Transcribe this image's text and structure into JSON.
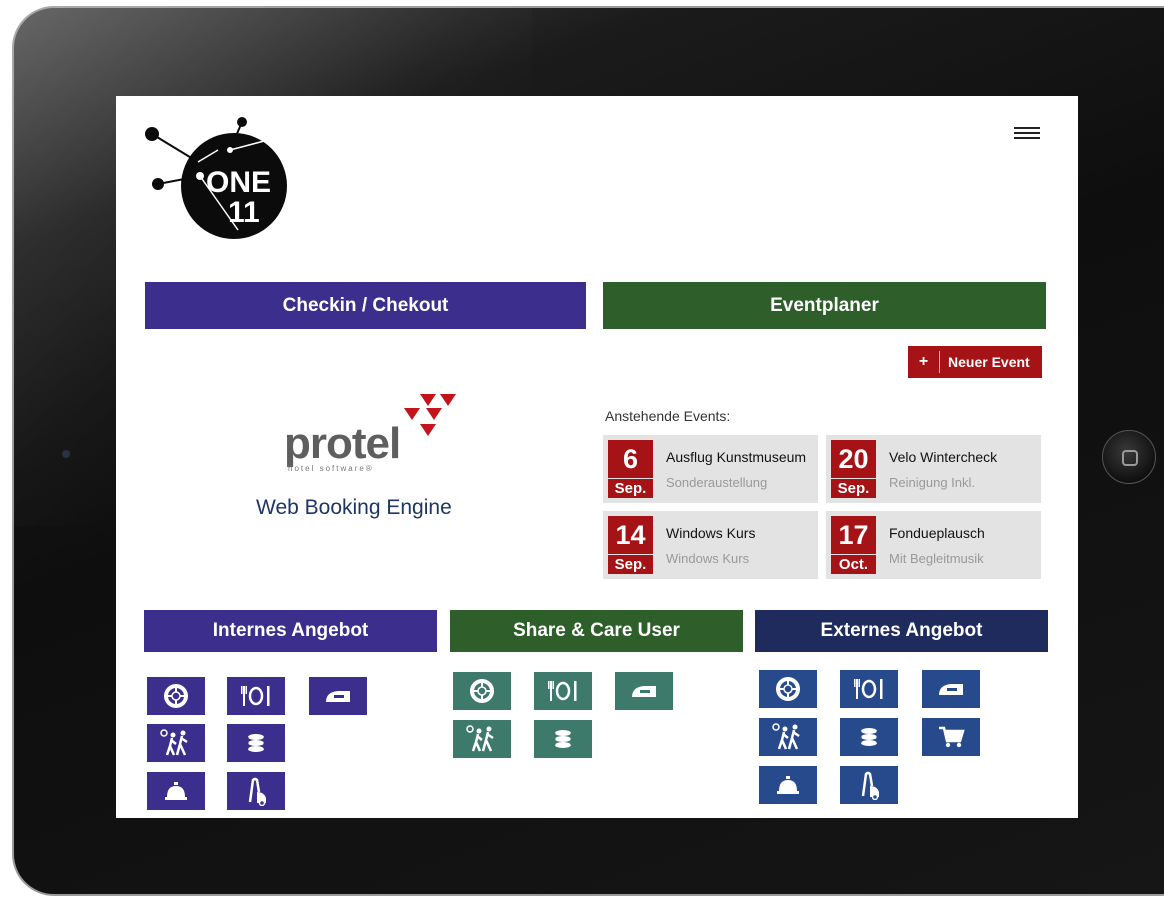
{
  "logo": {
    "line1": "ONE",
    "line2": "11"
  },
  "checkin": {
    "label": "Checkin / Chekout"
  },
  "protel": {
    "brand": "protel",
    "tagline": "hotel software®",
    "engine": "Web Booking Engine"
  },
  "eventplaner": {
    "label": "Eventplaner",
    "new_button_plus": "+",
    "new_button_label": "Neuer Event",
    "upcoming_label": "Anstehende Events:",
    "events": [
      {
        "day": "6",
        "month": "Sep.",
        "title": "Ausflug Kunstmuseum",
        "subtitle": "Sonderaustellung"
      },
      {
        "day": "20",
        "month": "Sep.",
        "title": "Velo Wintercheck",
        "subtitle": "Reinigung Inkl."
      },
      {
        "day": "14",
        "month": "Sep.",
        "title": "Windows Kurs",
        "subtitle": "Windows Kurs"
      },
      {
        "day": "17",
        "month": "Oct.",
        "title": "Fondueplausch",
        "subtitle": "Mit Begleitmusik"
      }
    ]
  },
  "sections": {
    "intern": {
      "label": "Internes Angebot",
      "color": "#3b2e8c"
    },
    "share": {
      "label": "Share & Care User",
      "color": "#3e7a6c"
    },
    "extern": {
      "label": "Externes Angebot",
      "color": "#264a8c"
    }
  },
  "colors": {
    "red": "#a51316",
    "purple": "#3b2e8c",
    "green": "#2e5e2a",
    "navy": "#1f2b5c"
  }
}
